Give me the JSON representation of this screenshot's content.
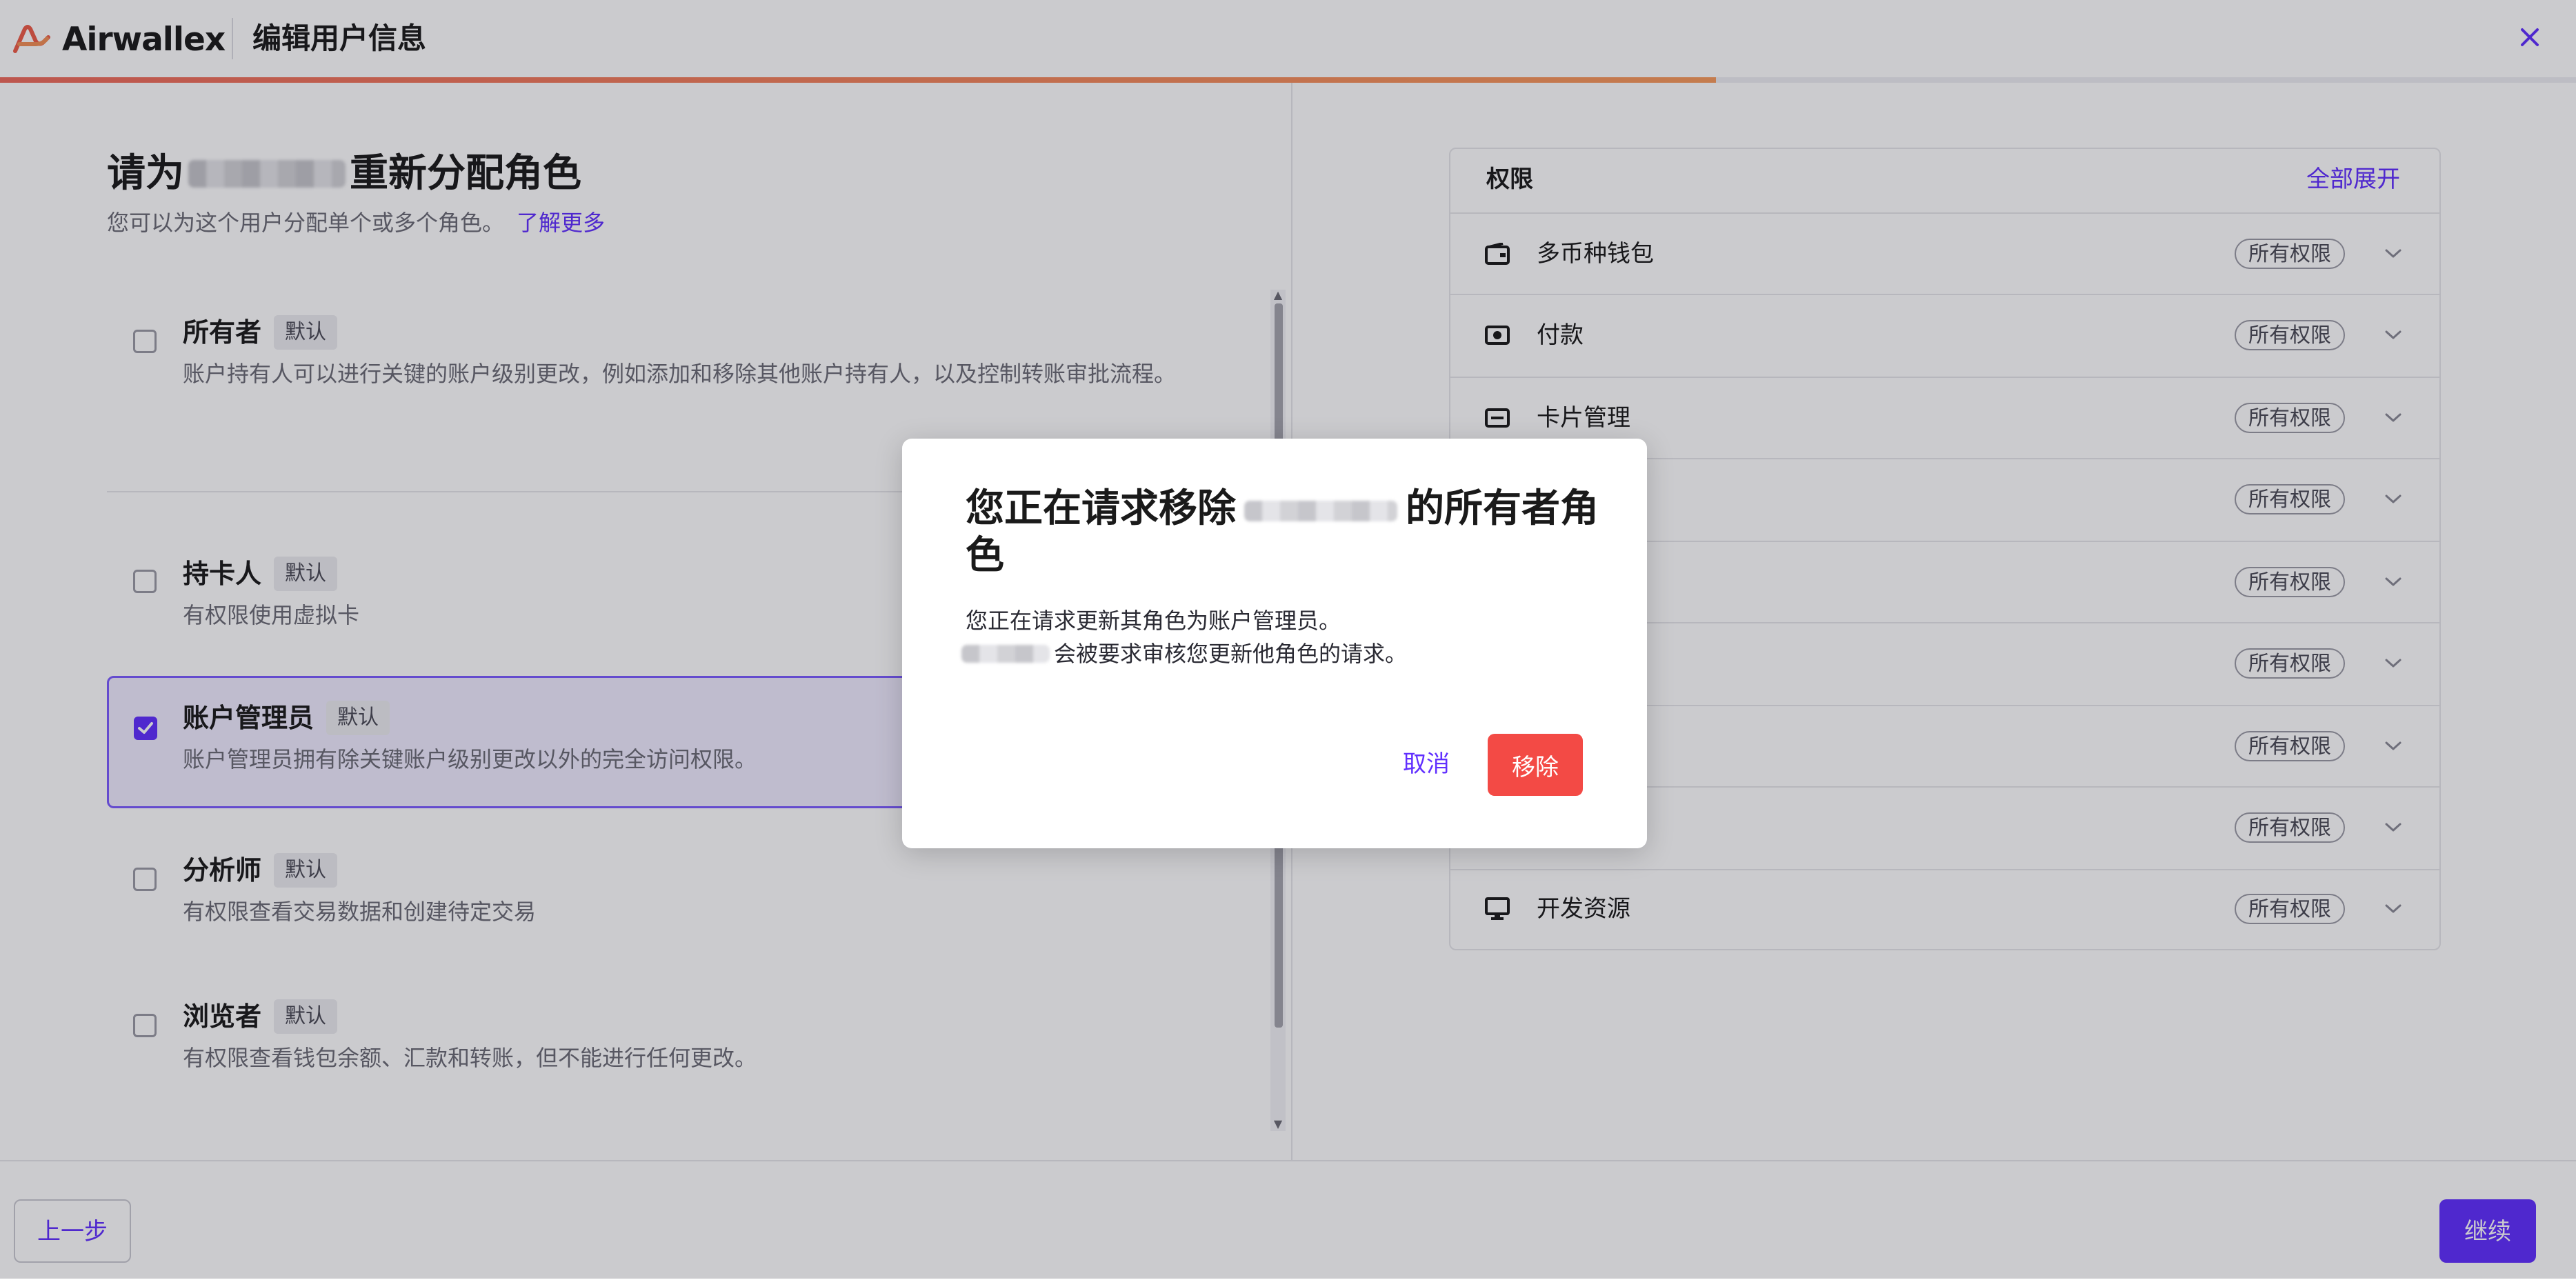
{
  "header": {
    "logo_text": "Airwallex",
    "title": "编辑用户信息",
    "progress": 0.666
  },
  "page": {
    "title_prefix": "请为",
    "title_suffix": "重新分配角色",
    "subtitle": "您可以为这个用户分配单个或多个角色。",
    "learn_more": "了解更多"
  },
  "roles": [
    {
      "name": "所有者",
      "tag": "默认",
      "desc": "账户持有人可以进行关键的账户级别更改，例如添加和移除其他账户持有人，以及控制转账审批流程。",
      "checked": false
    },
    {
      "name": "持卡人",
      "tag": "默认",
      "desc": "有权限使用虚拟卡",
      "checked": false
    },
    {
      "name": "账户管理员",
      "tag": "默认",
      "desc": "账户管理员拥有除关键账户级别更改以外的完全访问权限。",
      "checked": true
    },
    {
      "name": "分析师",
      "tag": "默认",
      "desc": "有权限查看交易数据和创建待定交易",
      "checked": false
    },
    {
      "name": "浏览者",
      "tag": "默认",
      "desc": "有权限查看钱包余额、汇款和转账，但不能进行任何更改。",
      "checked": false
    }
  ],
  "permissions": {
    "heading": "权限",
    "expand_all": "全部展开",
    "rows": [
      {
        "name": "多币种钱包",
        "badge": "所有权限",
        "icon": "wallet-icon"
      },
      {
        "name": "付款",
        "badge": "所有权限",
        "icon": "payment-icon"
      },
      {
        "name": "卡片管理",
        "badge": "所有权限",
        "icon": "card-icon"
      },
      {
        "name": "",
        "badge": "所有权限",
        "icon": ""
      },
      {
        "name": "",
        "badge": "所有权限",
        "icon": ""
      },
      {
        "name": "",
        "badge": "所有权限",
        "icon": ""
      },
      {
        "name": "",
        "badge": "所有权限",
        "icon": ""
      },
      {
        "name": "",
        "badge": "所有权限",
        "icon": ""
      },
      {
        "name": "开发资源",
        "badge": "所有权限",
        "icon": "monitor-icon"
      }
    ]
  },
  "modal": {
    "title_prefix": "您正在请求移除",
    "title_suffix": "的所有者角色",
    "line1": "您正在请求更新其角色为账户管理员。",
    "line2_suffix": "会被要求审核您更新他角色的请求。",
    "cancel": "取消",
    "remove": "移除"
  },
  "footer": {
    "back": "上一步",
    "next": "继续"
  },
  "colors": {
    "accent": "#612FFF",
    "danger": "#F34A45",
    "progress_start": "#EE6A5C",
    "progress_end": "#F79A5B"
  }
}
